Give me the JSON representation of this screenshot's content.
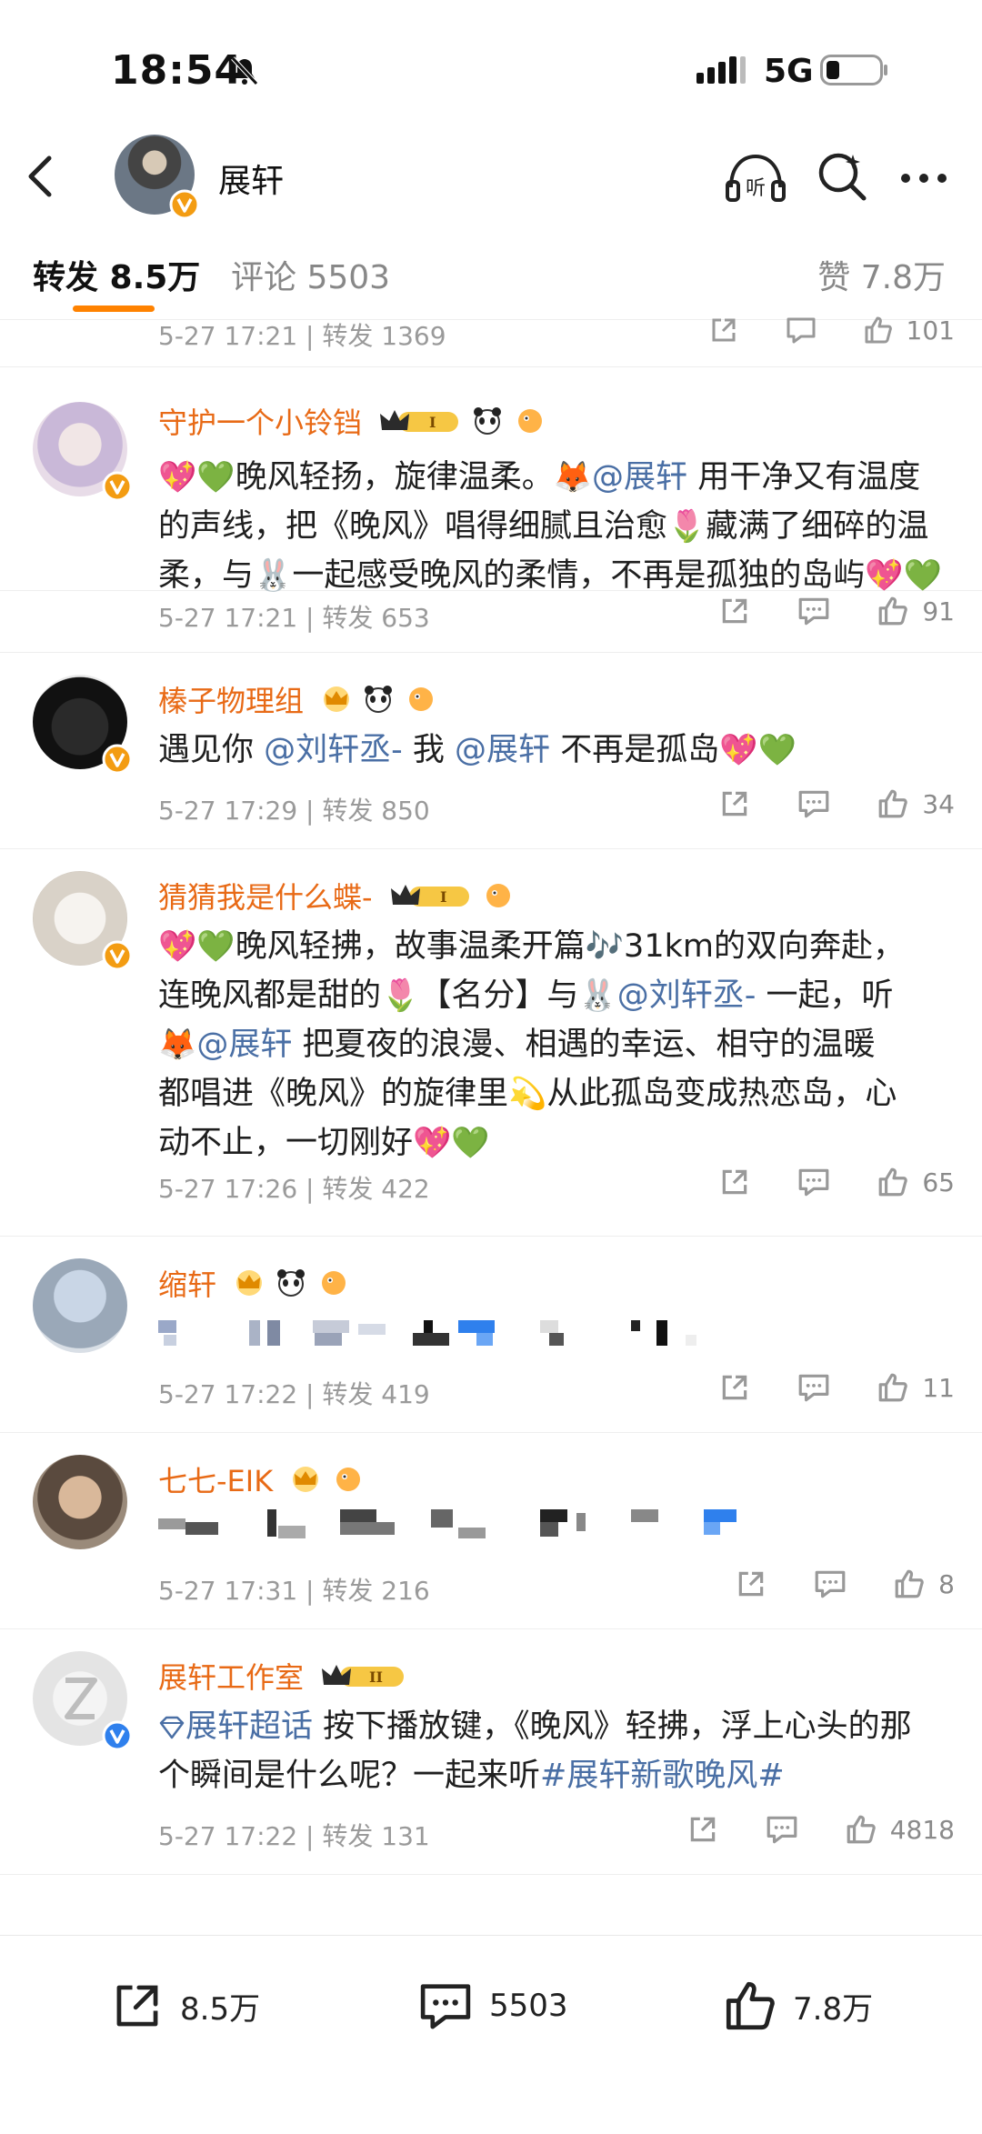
{
  "status": {
    "time": "18:54",
    "network": "5G"
  },
  "header": {
    "title": "展轩"
  },
  "tabs": {
    "repost": "转发 8.5万",
    "comment": "评论 5503",
    "like": "赞 7.8万"
  },
  "previous": {
    "meta": "5-27 17:21 | 转发 1369",
    "likes": "101"
  },
  "posts": [
    {
      "name": "守护一个小铃铛",
      "body_pre": "晚风轻扬，旋律温柔。",
      "mention": "@展轩",
      "body_post": " 用干净又有温度的声线，把《晚风》唱得细腻且治愈",
      "body_tail": "藏满了细碎的温柔，与",
      "body_tail2": "一起感受晚风的柔情，不再是孤独的岛屿",
      "meta": "5-27 17:21 | 转发 653",
      "likes": "91"
    },
    {
      "name": "榛子物理组",
      "body_pre": "遇见你 ",
      "mention1": "@刘轩丞-",
      "body_mid": "  我 ",
      "mention2": "@展轩",
      "body_post": " 不再是孤岛",
      "meta": "5-27 17:29 | 转发 850",
      "likes": "34"
    },
    {
      "name": "猜猜我是什么蝶-",
      "body1": "晚风轻拂，故事温柔开篇",
      "body1b": "31km的双向奔赴，",
      "body2a": "连晚风都是甜的",
      "body2b": "【名分】与",
      "mention1": "@刘轩丞-",
      "body2c": " 一起，听",
      "mention2": "@展轩",
      "body3": "  把夏夜的浪漫、相遇的幸运、相守的温暖",
      "body4a": "都唱进《晚风》的旋律里",
      "body4b": "从此孤岛变成热恋岛，心",
      "body5": "动不止，一切刚好",
      "meta": "5-27 17:26 | 转发 422",
      "likes": "65"
    },
    {
      "name": "缩轩",
      "meta": "5-27 17:22 | 转发 419",
      "likes": "11"
    },
    {
      "name": "七七-EIK",
      "meta": "5-27 17:31 | 转发 216",
      "likes": "8"
    },
    {
      "name": "展轩工作室",
      "topic": "展轩超话",
      "body1": " 按下播放键，《晚风》轻拂，浮上心头的那",
      "body2": "个瞬间是什么呢？一起来听",
      "hashtag": "#展轩新歌晚风#",
      "meta": "5-27 17:22 | 转发 131",
      "likes": "4818"
    }
  ],
  "bottom": {
    "repost": "8.5万",
    "comment": "5503",
    "like": "7.8万"
  },
  "colors": {
    "accent": "#ff8200",
    "username": "#e86a16",
    "mention": "#4a6fa5",
    "verified_orange": "#f39c12",
    "verified_blue": "#2f80ed"
  }
}
